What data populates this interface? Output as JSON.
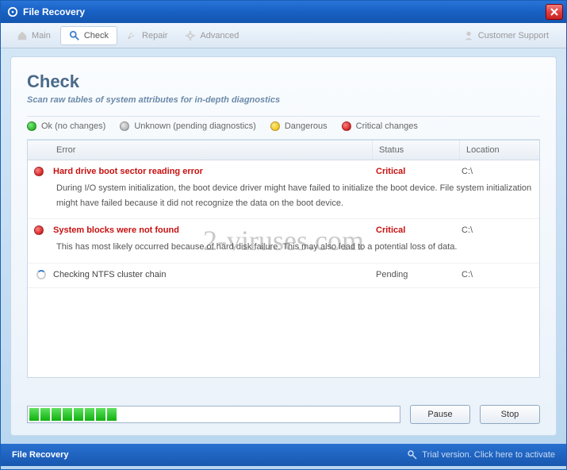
{
  "window": {
    "title": "File Recovery"
  },
  "toolbar": {
    "main": "Main",
    "check": "Check",
    "repair": "Repair",
    "advanced": "Advanced",
    "support": "Customer Support"
  },
  "page": {
    "title": "Check",
    "subtitle": "Scan raw tables of system attributes for in-depth diagnostics"
  },
  "legend": {
    "ok": "Ok (no changes)",
    "unknown": "Unknown (pending diagnostics)",
    "dangerous": "Dangerous",
    "critical": "Critical changes"
  },
  "table": {
    "headers": {
      "error": "Error",
      "status": "Status",
      "location": "Location"
    },
    "rows": [
      {
        "kind": "critical",
        "title": "Hard drive boot sector reading error",
        "status": "Critical",
        "location": "C:\\",
        "desc": "During I/O system initialization, the boot device driver might have failed to initialize the boot device. File system initialization might have failed because it did not recognize the data on the boot device."
      },
      {
        "kind": "critical",
        "title": "System blocks were not found",
        "status": "Critical",
        "location": "C:\\",
        "desc": "This has most likely occurred because of hard disk failure. This may also lead to a potential loss of data."
      },
      {
        "kind": "pending",
        "title": "Checking NTFS cluster chain",
        "status": "Pending",
        "location": "C:\\",
        "desc": ""
      }
    ]
  },
  "buttons": {
    "pause": "Pause",
    "stop": "Stop"
  },
  "statusbar": {
    "left": "File Recovery",
    "right": "Trial version. Click here to activate"
  },
  "watermark": "2-viruses.com",
  "progress": {
    "segments": 8
  }
}
